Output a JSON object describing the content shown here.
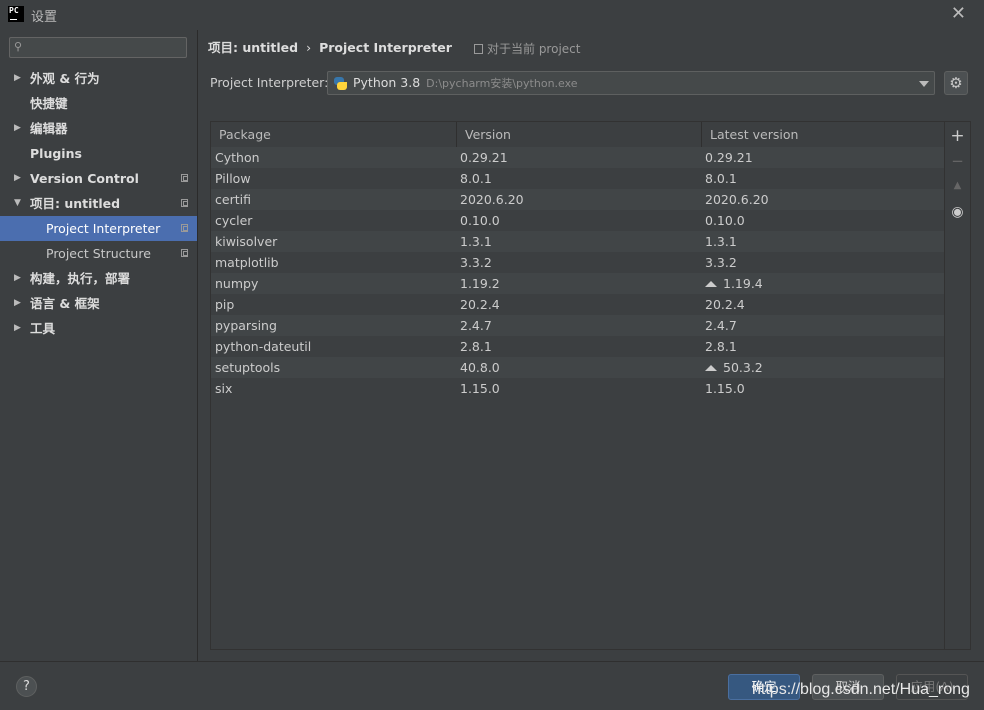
{
  "window": {
    "logo_text": "PC",
    "title": "设置"
  },
  "sidebar": {
    "search_placeholder": "",
    "items": [
      {
        "label": "外观 & 行为",
        "arrow": "▶",
        "bold": true
      },
      {
        "label": "快捷键",
        "arrow": "",
        "bold": true
      },
      {
        "label": "编辑器",
        "arrow": "▶",
        "bold": true
      },
      {
        "label": "Plugins",
        "arrow": "",
        "bold": true
      },
      {
        "label": "Version Control",
        "arrow": "▶",
        "bold": true
      },
      {
        "label": "项目: untitled",
        "arrow": "▼",
        "bold": true
      },
      {
        "label": "Project Interpreter",
        "arrow": "",
        "bold": false
      },
      {
        "label": "Project Structure",
        "arrow": "",
        "bold": false
      },
      {
        "label": "构建，执行，部署",
        "arrow": "▶",
        "bold": true
      },
      {
        "label": "语言 & 框架",
        "arrow": "▶",
        "bold": true
      },
      {
        "label": "工具",
        "arrow": "▶",
        "bold": true
      }
    ]
  },
  "breadcrumb": {
    "project": "项目: untitled",
    "separator": "›",
    "page": "Project Interpreter",
    "scope": "对于当前 project"
  },
  "interpreter": {
    "label": "Project Interpreter:",
    "name": "Python 3.8",
    "path": "D:\\pycharm安装\\python.exe"
  },
  "table": {
    "columns": [
      "Package",
      "Version",
      "Latest version"
    ],
    "rows": [
      {
        "package": "Cython",
        "version": "0.29.21",
        "latest": "0.29.21",
        "upgrade": false
      },
      {
        "package": "Pillow",
        "version": "8.0.1",
        "latest": "8.0.1",
        "upgrade": false
      },
      {
        "package": "certifi",
        "version": "2020.6.20",
        "latest": "2020.6.20",
        "upgrade": false
      },
      {
        "package": "cycler",
        "version": "0.10.0",
        "latest": "0.10.0",
        "upgrade": false
      },
      {
        "package": "kiwisolver",
        "version": "1.3.1",
        "latest": "1.3.1",
        "upgrade": false
      },
      {
        "package": "matplotlib",
        "version": "3.3.2",
        "latest": "3.3.2",
        "upgrade": false
      },
      {
        "package": "numpy",
        "version": "1.19.2",
        "latest": "1.19.4",
        "upgrade": true
      },
      {
        "package": "pip",
        "version": "20.2.4",
        "latest": "20.2.4",
        "upgrade": false
      },
      {
        "package": "pyparsing",
        "version": "2.4.7",
        "latest": "2.4.7",
        "upgrade": false
      },
      {
        "package": "python-dateutil",
        "version": "2.8.1",
        "latest": "2.8.1",
        "upgrade": false
      },
      {
        "package": "setuptools",
        "version": "40.8.0",
        "latest": "50.3.2",
        "upgrade": true
      },
      {
        "package": "six",
        "version": "1.15.0",
        "latest": "1.15.0",
        "upgrade": false
      }
    ]
  },
  "tools": {
    "add": "+",
    "remove": "−",
    "upgrade": "▲",
    "show": "◉"
  },
  "footer": {
    "help": "?",
    "ok": "确定",
    "cancel": "取消",
    "apply": "应用(A)",
    "watermark": "https://blog.csdn.net/Hua_rong"
  },
  "colors": {
    "background": "#3c3f41",
    "selection": "#4b6eaf",
    "ok_button": "#365880"
  }
}
